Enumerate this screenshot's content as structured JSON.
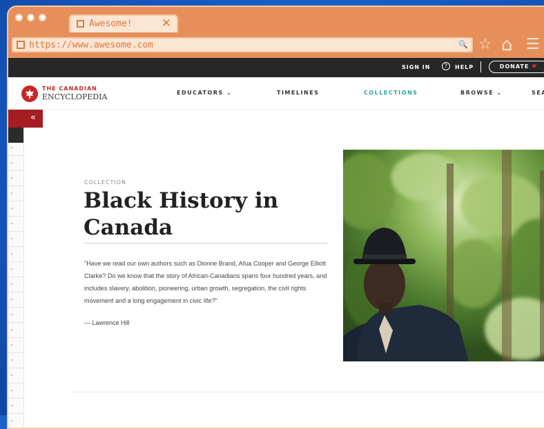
{
  "browser": {
    "tab_title": "Awesome!",
    "close_glyph": "✕",
    "url": "https://www.awesome.com",
    "search_glyph": "🔍",
    "star_glyph": "☆",
    "home_glyph": "⌂",
    "menu_glyph": "☰"
  },
  "utility_bar": {
    "sign_in": "SIGN IN",
    "help_glyph": "?",
    "help": "HELP",
    "donate": "DONATE",
    "heart": "♥"
  },
  "brand": {
    "line1": "THE CANADIAN",
    "line2": "ENCYCLOPEDIA",
    "accent": "#c62828"
  },
  "nav": {
    "educators": "EDUCATORS ⌄",
    "timelines": "TIMELINES",
    "collections": "COLLECTIONS",
    "browse": "BROWSE ⌄",
    "search": "SEAR"
  },
  "sidebar": {
    "collapse_glyph": "«",
    "chevron": "⌄"
  },
  "article": {
    "eyebrow": "COLLECTION",
    "title": "Black History in Canada",
    "quote": "\"Have we read our own authors such as Dionne Brand, Afua Cooper and George Elliott Clarke? Do we know that the story of African-Canadians spans four hundred years, and includes slavery, abolition, pioneering, urban growth, segregation, the civil rights movement and a long engagement in civic life?\"",
    "author": "— Lawrence Hill"
  },
  "colors": {
    "frame": "#e68f5b",
    "frame_light": "#fbe5d3",
    "active_nav": "#2aa0a0",
    "sidebar_red": "#a51d22",
    "background": "#1a62c9"
  }
}
